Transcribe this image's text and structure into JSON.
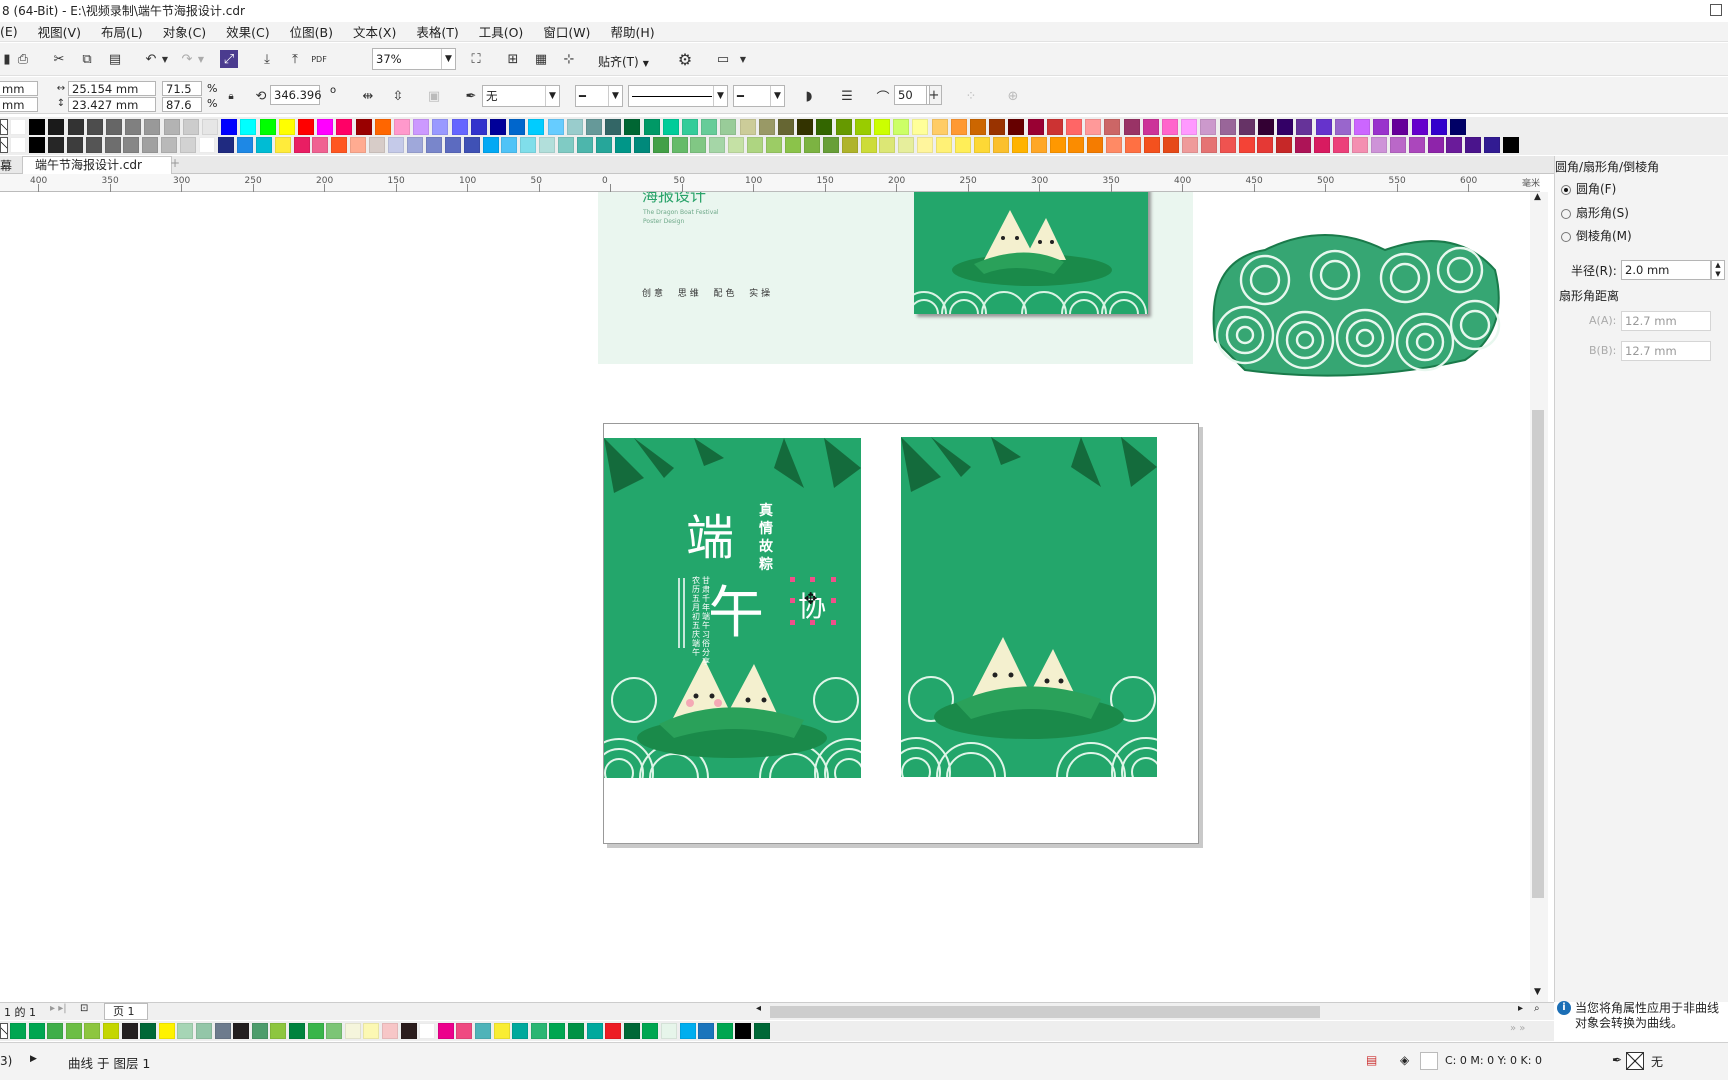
{
  "titlebar": {
    "title": "8 (64-Bit) - E:\\视频录制\\端午节海报设计.cdr"
  },
  "menu": [
    "(E)",
    "视图(V)",
    "布局(L)",
    "对象(C)",
    "效果(C)",
    "位图(B)",
    "文本(X)",
    "表格(T)",
    "工具(O)",
    "窗口(W)",
    "帮助(H)"
  ],
  "toolbar": {
    "zoom": "37%",
    "snap_label": "贴齐(T)",
    "pdf_label": "PDF"
  },
  "propbar": {
    "x_unit": "mm",
    "y_unit": "mm",
    "width": "25.154 mm",
    "height": "23.427 mm",
    "scale_w": "71.5",
    "scale_h": "87.6",
    "percent": "%",
    "rotation": "346.396",
    "rotation_unit": "o",
    "outline_fill": "无",
    "smooth_value": "50"
  },
  "palette": {
    "row1": [
      "#ffffff",
      "#000000",
      "#1a1a1a",
      "#333333",
      "#4d4d4d",
      "#666666",
      "#808080",
      "#999999",
      "#b3b3b3",
      "#cccccc",
      "#e6e6e6",
      "#0000ff",
      "#00ffff",
      "#00ff00",
      "#ffff00",
      "#ff0000",
      "#ff00ff",
      "#ff0066",
      "#990000",
      "#ff6600",
      "#ff99cc",
      "#cc99ff",
      "#9999ff",
      "#6666ff",
      "#3333cc",
      "#000099",
      "#0066cc",
      "#00ccff",
      "#66ccff",
      "#99cccc",
      "#669999",
      "#336666",
      "#006633",
      "#009966",
      "#00cc99",
      "#33cc99",
      "#66cc99",
      "#99cc99",
      "#cccc99",
      "#999966",
      "#666633",
      "#333300",
      "#336600",
      "#669900",
      "#99cc00",
      "#ccff00",
      "#ccff66",
      "#ffff99",
      "#ffcc66",
      "#ff9933",
      "#cc6600",
      "#993300",
      "#660000",
      "#990033",
      "#cc3333",
      "#ff6666",
      "#ff9999",
      "#cc6666",
      "#993366",
      "#cc3399",
      "#ff66cc",
      "#ff99ff",
      "#cc99cc",
      "#996699",
      "#663366",
      "#330033",
      "#330066",
      "#663399",
      "#6633cc",
      "#9966cc",
      "#cc66ff",
      "#9933cc",
      "#660099",
      "#6600cc",
      "#3300cc",
      "#000066"
    ],
    "row2": [
      "#ffffff",
      "#000000",
      "#262626",
      "#3d3d3d",
      "#555555",
      "#6e6e6e",
      "#878787",
      "#a0a0a0",
      "#b9b9b9",
      "#d2d2d2",
      "#ffffff",
      "#1f2a80",
      "#1e88e5",
      "#00bcd4",
      "#ffeb3b",
      "#e91e63",
      "#f06292",
      "#ff5722",
      "#ffab91",
      "#d7ccc8",
      "#c5cae9",
      "#9fa8da",
      "#7986cb",
      "#5c6bc0",
      "#3f51b5",
      "#03a9f4",
      "#4fc3f7",
      "#80deea",
      "#b2dfdb",
      "#80cbc4",
      "#4db6ac",
      "#26a69a",
      "#009688",
      "#00897b",
      "#43a047",
      "#66bb6a",
      "#81c784",
      "#a5d6a7",
      "#c5e1a5",
      "#aed581",
      "#9ccc65",
      "#8bc34a",
      "#7cb342",
      "#689f38",
      "#afb42b",
      "#cddc39",
      "#dce775",
      "#e6ee9c",
      "#fff59d",
      "#fff176",
      "#ffee58",
      "#fdd835",
      "#fbc02d",
      "#ffb300",
      "#ffa726",
      "#ff9800",
      "#fb8c00",
      "#f57c00",
      "#ff8a65",
      "#ff7043",
      "#f4511e",
      "#e64a19",
      "#ef9a9a",
      "#e57373",
      "#ef5350",
      "#f44336",
      "#e53935",
      "#c62828",
      "#ad1457",
      "#d81b60",
      "#ec407a",
      "#f48fb1",
      "#ce93d8",
      "#ba68c8",
      "#ab47bc",
      "#8e24aa",
      "#6a1b9a",
      "#4a148c",
      "#311b92",
      "#000000"
    ]
  },
  "doctab": {
    "filename": "端午节海报设计.cdr",
    "left_label": "幕",
    "add": "+"
  },
  "ruler": {
    "ticks": [
      "400",
      "350",
      "300",
      "250",
      "200",
      "150",
      "100",
      "50",
      "0",
      "50",
      "100",
      "150",
      "200",
      "250",
      "300",
      "350",
      "400",
      "450",
      "500",
      "550",
      "600"
    ],
    "unit": "毫米"
  },
  "canvas": {
    "topcard": {
      "title": "海报设计",
      "sub1": "The Dragon Boat Festival",
      "sub2": "Poster Design",
      "tagline": "创意  思维  配色  实操"
    },
    "poster1": {
      "big1": "端",
      "big2": "午",
      "side1": "真",
      "side2": "情",
      "side3": "故",
      "side4": "粽",
      "vert1": "农历五月初五庆端午",
      "vert2": "甘肃千年端午习俗分享",
      "sel_char": "协"
    }
  },
  "dock": {
    "title": "圆角/扇形角/倒棱角",
    "options": [
      "圆角(F)",
      "扇形角(S)",
      "倒棱角(M)"
    ],
    "radius_label": "半径(R):",
    "radius_value": "2.0 mm",
    "scallop_label": "扇形角距离",
    "a_label": "A(A):",
    "a_value": "12.7 mm",
    "b_label": "B(B):",
    "b_value": "12.7 mm",
    "hint": "当您将角属性应用于非曲线对象会转换为曲线。"
  },
  "pagebar": {
    "pages": "1 的 1",
    "page_tab": "页 1"
  },
  "docpal": [
    "#00a651",
    "#00a651",
    "#3fae49",
    "#6cbe45",
    "#8dc63f",
    "#c4d600",
    "#231f20",
    "#006837",
    "#fff200",
    "#a6d5b5",
    "#93c6a8",
    "#6d7b8d",
    "#231f20",
    "#4d9c6b",
    "#8dc63f",
    "#00833e",
    "#39b54a",
    "#7cc576",
    "#f5f5dc",
    "#fcf8b3",
    "#f7c6c7",
    "#2b1d1d",
    "#ffffff",
    "#ec008c",
    "#ef4a81",
    "#4eb3b9",
    "#f9ed32",
    "#00a99d",
    "#2bb673",
    "#00a651",
    "#009245",
    "#00a99d",
    "#ed1c24",
    "#006837",
    "#00a651",
    "#e6f5ea",
    "#00aeef",
    "#1b75bc",
    "#00a651",
    "#000000",
    "#006837"
  ],
  "status": {
    "layer": "曲线 于 图层 1",
    "fill": "C: 0 M: 0 Y: 0 K: 0",
    "outline": "无",
    "left": "3)"
  }
}
